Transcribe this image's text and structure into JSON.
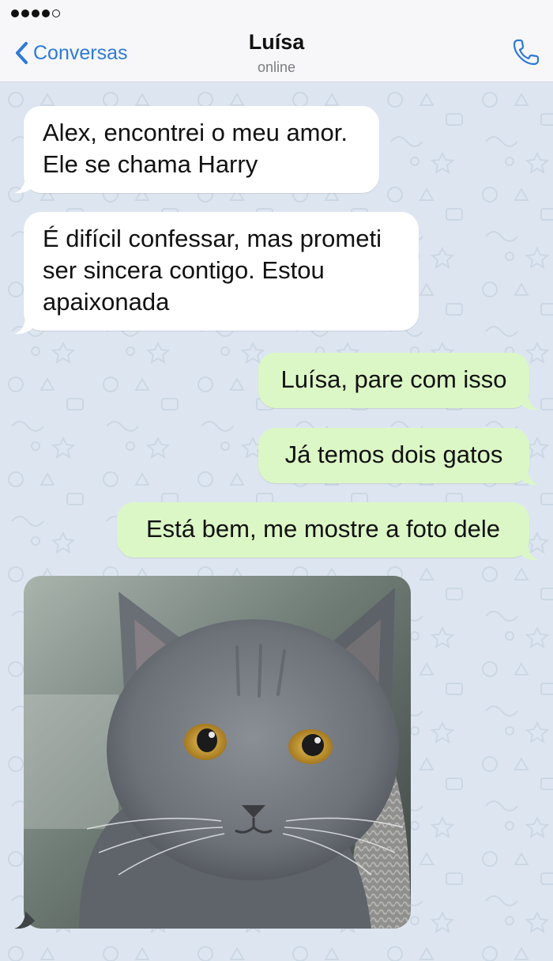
{
  "status_bar": {
    "signal_strength": 4,
    "signal_max": 5
  },
  "header": {
    "back_label": "Conversas",
    "contact_name": "Luísa",
    "contact_status": "online",
    "accent_color": "#2f7ad6"
  },
  "messages": [
    {
      "direction": "incoming",
      "text_lines": [
        "Alex, encontrei o meu amor.",
        "Ele se chama Harry"
      ]
    },
    {
      "direction": "incoming",
      "text_lines": [
        "É difícil confessar, mas prometi",
        "ser sincera contigo. Estou",
        "apaixonada"
      ]
    },
    {
      "direction": "outgoing",
      "text": "Luísa, pare com isso"
    },
    {
      "direction": "outgoing",
      "text": "Já temos dois gatos"
    },
    {
      "direction": "outgoing",
      "text": "Está bem, me mostre a foto dele"
    },
    {
      "direction": "incoming",
      "type": "photo",
      "subject": "gray cat"
    }
  ],
  "colors": {
    "incoming_bubble": "#ffffff",
    "outgoing_bubble": "#dcf7c6",
    "chat_background": "#dde6f0"
  }
}
